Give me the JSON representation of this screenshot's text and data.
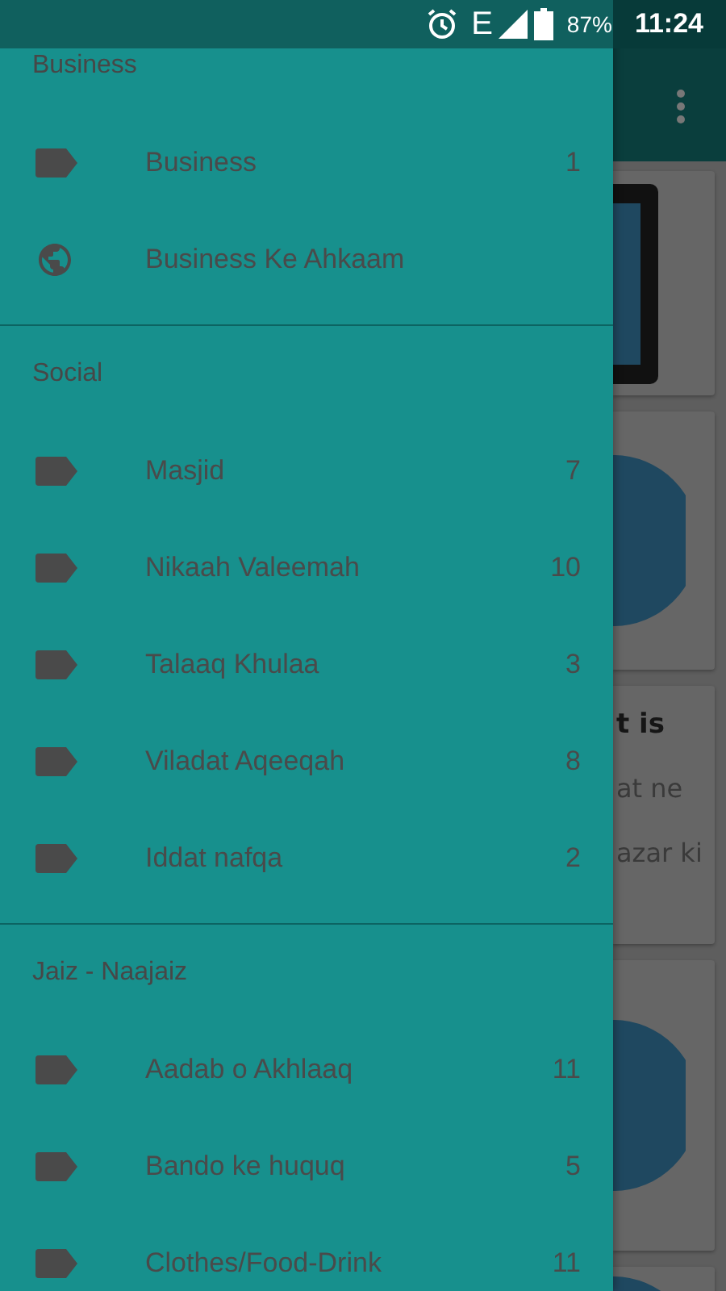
{
  "status_bar": {
    "network": "E",
    "battery": "87%",
    "time": "11:24"
  },
  "background_cards": [
    {
      "kind": "tablet"
    },
    {
      "kind": "circle"
    },
    {
      "kind": "text",
      "title": "t is",
      "lines": [
        "at ne",
        "azar ki"
      ]
    },
    {
      "kind": "circle"
    },
    {
      "kind": "circle"
    }
  ],
  "drawer": {
    "sections": [
      {
        "title": "Business",
        "items": [
          {
            "kind": "tag",
            "label": "Business",
            "count": "1"
          },
          {
            "kind": "globe",
            "label": "Business Ke Ahkaam"
          }
        ]
      },
      {
        "title": "Social",
        "items": [
          {
            "kind": "tag",
            "label": "Masjid",
            "count": "7"
          },
          {
            "kind": "tag",
            "label": "Nikaah Valeemah",
            "count": "10"
          },
          {
            "kind": "tag",
            "label": "Talaaq Khulaa",
            "count": "3"
          },
          {
            "kind": "tag",
            "label": "Viladat Aqeeqah",
            "count": "8"
          },
          {
            "kind": "tag",
            "label": "Iddat nafqa",
            "count": "2"
          }
        ]
      },
      {
        "title": "Jaiz - Naajaiz",
        "items": [
          {
            "kind": "tag",
            "label": "Aadab o Akhlaaq",
            "count": "11"
          },
          {
            "kind": "tag",
            "label": "Bando ke huquq",
            "count": "5"
          },
          {
            "kind": "tag",
            "label": "Clothes/Food-Drink",
            "count": "11"
          }
        ]
      }
    ]
  }
}
